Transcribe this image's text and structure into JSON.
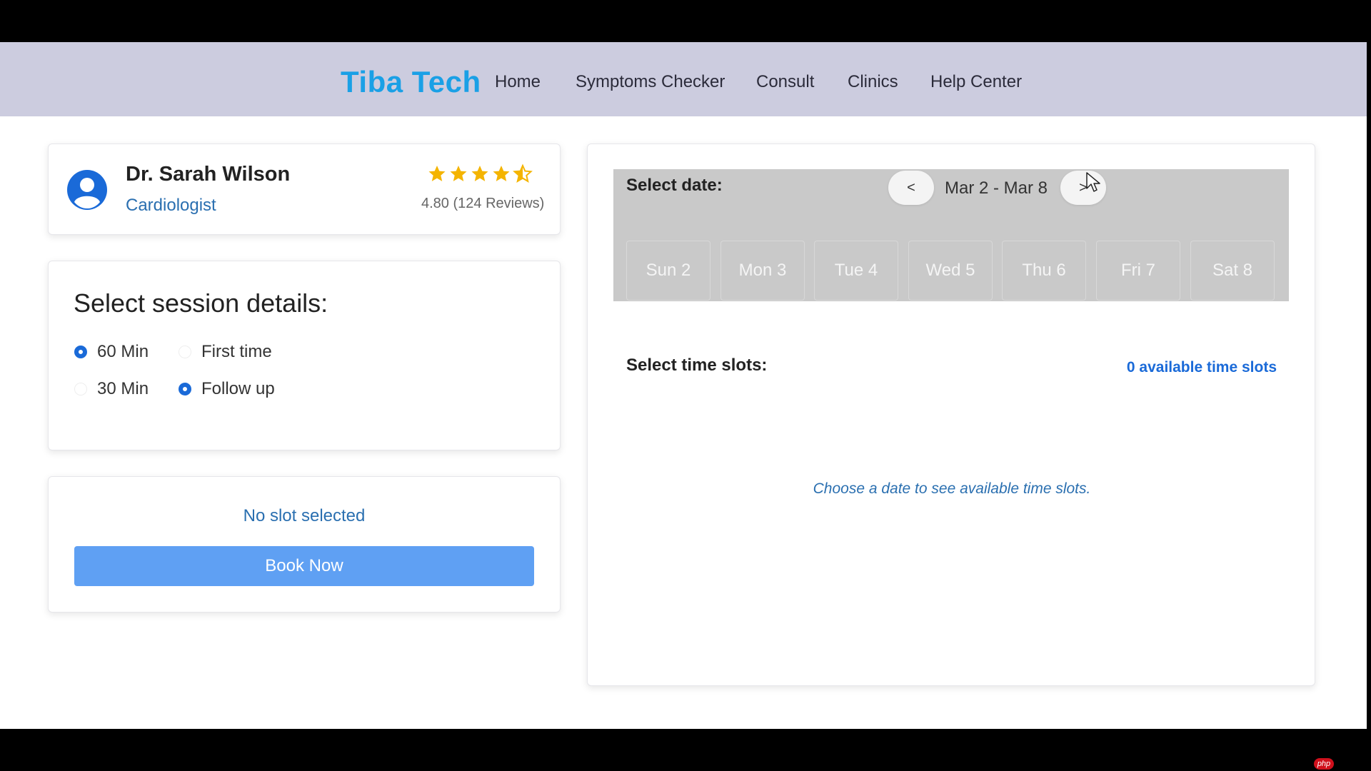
{
  "brand": "Tiba Tech",
  "nav": [
    "Home",
    "Symptoms Checker",
    "Consult",
    "Clinics",
    "Help Center"
  ],
  "doctor": {
    "name": "Dr. Sarah Wilson",
    "specialty": "Cardiologist",
    "rating": 4.8,
    "rating_text": "4.80 (124 Reviews)"
  },
  "session": {
    "title": "Select session details:",
    "durations": [
      {
        "label": "60 Min",
        "checked": true
      },
      {
        "label": "30 Min",
        "checked": false
      }
    ],
    "types": [
      {
        "label": "First time",
        "checked": false
      },
      {
        "label": "Follow up",
        "checked": true
      }
    ]
  },
  "booking": {
    "status": "No slot selected",
    "button": "Book Now"
  },
  "calendar": {
    "select_date_label": "Select date:",
    "prev": "<",
    "next": ">",
    "week_range": "Mar 2 - Mar 8",
    "days": [
      "Sun 2",
      "Mon 3",
      "Tue 4",
      "Wed 5",
      "Thu 6",
      "Fri 7",
      "Sat 8"
    ]
  },
  "slots": {
    "label": "Select time slots:",
    "available": "0 available time slots",
    "empty_message": "Choose a date to see available time slots."
  },
  "colors": {
    "navbar_bg": "#ccccdf",
    "brand": "#1aa0e6",
    "accent": "#1a6ad8",
    "book_button": "#5fa0f3",
    "star": "#f4b400"
  },
  "watermark": "php"
}
